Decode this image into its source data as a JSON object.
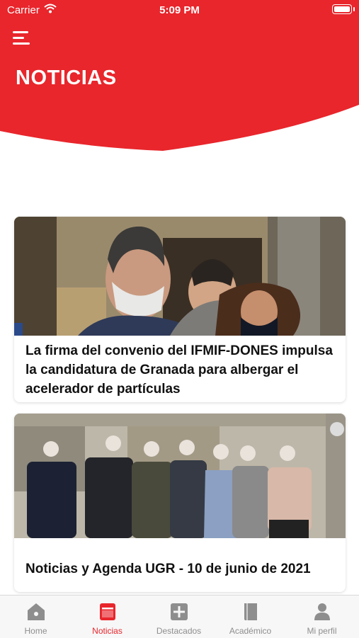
{
  "status_bar": {
    "carrier": "Carrier",
    "time": "5:09 PM"
  },
  "header": {
    "title": "NOTICIAS",
    "color": "#e8262c"
  },
  "articles": [
    {
      "title": "La firma del convenio del IFMIF-DONES impulsa la candidatura de Granada para albergar el acelerador de partículas"
    },
    {
      "title": "Noticias y Agenda UGR - 10 de junio de 2021"
    }
  ],
  "tabs": [
    {
      "label": "Home",
      "icon": "home-icon"
    },
    {
      "label": "Noticias",
      "icon": "news-icon",
      "active": true
    },
    {
      "label": "Destacados",
      "icon": "plus-square-icon"
    },
    {
      "label": "Académico",
      "icon": "book-icon"
    },
    {
      "label": "Mi perfil",
      "icon": "person-icon"
    }
  ]
}
